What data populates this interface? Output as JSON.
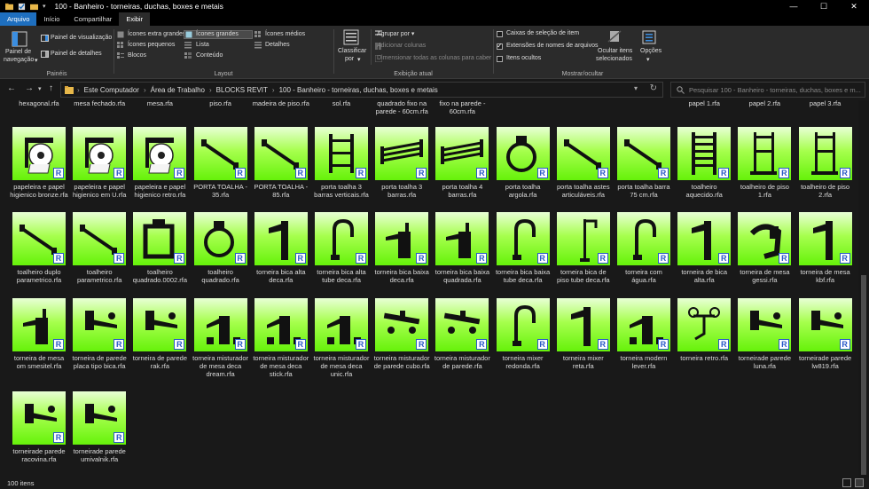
{
  "window": {
    "title": "100 - Banheiro - torneiras, duchas, boxes e metais",
    "min_glyph": "—",
    "max_glyph": "☐",
    "close_glyph": "✕"
  },
  "tabs": [
    {
      "label": "Arquivo",
      "kind": "file"
    },
    {
      "label": "Início",
      "kind": ""
    },
    {
      "label": "Compartilhar",
      "kind": ""
    },
    {
      "label": "Exibir",
      "kind": "active"
    }
  ],
  "ribbon": {
    "panes": {
      "nav_pane_1": "Painel de",
      "nav_pane_2": "navegação",
      "nav_pane_arrow": "▾",
      "preview": "Painel de visualização",
      "details": "Painel de detalhes",
      "group": "Painéis"
    },
    "layout": {
      "extra_large": "Ícones extra grandes",
      "large": "Ícones grandes",
      "medium": "Ícones médios",
      "small": "Ícones pequenos",
      "list": "Lista",
      "details": "Detalhes",
      "tiles": "Blocos",
      "content": "Conteúdo",
      "group": "Layout"
    },
    "current_view": {
      "sort_1": "Classificar",
      "sort_2": "por",
      "sort_arrow": "▾",
      "group_by": "Agrupar por",
      "add_columns": "Adicionar colunas",
      "size_columns": "Dimensionar todas as colunas para caber",
      "group": "Exibição atual"
    },
    "show_hide": {
      "checkboxes": "Caixas de seleção de item",
      "extensions": "Extensões de nomes de arquivos",
      "hidden": "Itens ocultos",
      "hide_selected_1": "Ocultar itens",
      "hide_selected_2": "selecionados",
      "options": "Opções",
      "options_arrow": "▾",
      "group": "Mostrar/ocultar",
      "checkboxes_checked": false,
      "extensions_checked": true,
      "hidden_checked": false
    }
  },
  "address": {
    "back": "←",
    "forward": "→",
    "recent": "▾",
    "up": "↑",
    "crumbs": [
      "Este Computador",
      "Área de Trabalho",
      "BLOCKS REVIT",
      "100 - Banheiro - torneiras, duchas, boxes e metais"
    ],
    "dropdown": "▾",
    "refresh": "↻",
    "search_placeholder": "Pesquisar 100 - Banheiro - torneiras, duchas, boxes e m...",
    "crumb_sep": "›"
  },
  "partial_row": [
    "hexagonal.rfa",
    "mesa fechado.rfa",
    "mesa.rfa",
    "piso.rfa",
    "madeira de piso.rfa",
    "sol.rfa",
    "quadrado fixo na parede - 60cm.rfa",
    "fixo na parede - 60cm.rfa",
    "",
    "",
    "",
    "papel 1.rfa",
    "papel 2.rfa",
    "papel 3.rfa"
  ],
  "files": [
    {
      "name": "papeleira e papel higienico bronze.rfa",
      "icon": "toilet-paper-holder-icon"
    },
    {
      "name": "papeleira e papel higienico em U.rfa",
      "icon": "toilet-paper-holder-icon"
    },
    {
      "name": "papeleira e papel higienico retro.rfa",
      "icon": "toilet-paper-holder-icon"
    },
    {
      "name": "PORTA TOALHA - 35.rfa",
      "icon": "towel-bar-icon"
    },
    {
      "name": "PORTA TOALHA - 85.rfa",
      "icon": "towel-bar-icon"
    },
    {
      "name": "porta toalha 3 barras verticais.rfa",
      "icon": "towel-rack-icon"
    },
    {
      "name": "porta toalha 3 barras.rfa",
      "icon": "towel-shelf-icon"
    },
    {
      "name": "porta toalha 4 barras.rfa",
      "icon": "towel-shelf-icon"
    },
    {
      "name": "porta toalha argola.rfa",
      "icon": "towel-ring-icon"
    },
    {
      "name": "porta toalha astes articuláveis.rfa",
      "icon": "towel-bar-icon"
    },
    {
      "name": "porta toalha barra 75 cm.rfa",
      "icon": "towel-bar-icon"
    },
    {
      "name": "toalheiro aquecido.rfa",
      "icon": "heated-towel-rail-icon"
    },
    {
      "name": "toalheiro de piso 1.rfa",
      "icon": "floor-towel-stand-icon"
    },
    {
      "name": "toalheiro de piso 2.rfa",
      "icon": "floor-towel-stand-icon"
    },
    {
      "name": "toalheiro duplo parametrico.rfa",
      "icon": "towel-bar-icon"
    },
    {
      "name": "toalheiro parametrico.rfa",
      "icon": "towel-bar-icon"
    },
    {
      "name": "toalheiro quadrado.0002.rfa",
      "icon": "square-towel-ring-icon"
    },
    {
      "name": "toalheiro quadrado.rfa",
      "icon": "towel-ring-icon"
    },
    {
      "name": "torneira bica alta deca.rfa",
      "icon": "tall-faucet-icon"
    },
    {
      "name": "torneira bica alta tube deca.rfa",
      "icon": "gooseneck-faucet-icon"
    },
    {
      "name": "torneira bica baixa deca.rfa",
      "icon": "low-faucet-icon"
    },
    {
      "name": "torneira bica baixa quadrada.rfa",
      "icon": "low-faucet-icon"
    },
    {
      "name": "torneira bica baixa tube deca.rfa",
      "icon": "gooseneck-faucet-icon"
    },
    {
      "name": "torneira bica de piso tube deca.rfa",
      "icon": "floor-faucet-icon"
    },
    {
      "name": "torneira com água.rfa",
      "icon": "gooseneck-faucet-icon"
    },
    {
      "name": "torneira de bica alta.rfa",
      "icon": "tall-faucet-icon"
    },
    {
      "name": "torneira de mesa gessi.rfa",
      "icon": "curved-faucet-icon"
    },
    {
      "name": "torneira de mesa kbf.rfa",
      "icon": "tall-faucet-icon"
    },
    {
      "name": "torneira de mesa om smesitel.rfa",
      "icon": "low-faucet-icon"
    },
    {
      "name": "torneira de parede placa tipo bica.rfa",
      "icon": "wall-faucet-icon"
    },
    {
      "name": "torneira de parede rak.rfa",
      "icon": "wall-faucet-icon"
    },
    {
      "name": "torneira misturador de mesa deca dream.rfa",
      "icon": "mixer-faucet-icon"
    },
    {
      "name": "torneira misturador de mesa deca stick.rfa",
      "icon": "mixer-faucet-icon"
    },
    {
      "name": "torneira misturador de mesa deca unic.rfa",
      "icon": "mixer-faucet-icon"
    },
    {
      "name": "torneira misturador de parede cubo.rfa",
      "icon": "wall-mixer-icon"
    },
    {
      "name": "torneira misturador de parede.rfa",
      "icon": "wall-mixer-icon"
    },
    {
      "name": "torneira mixer redonda.rfa",
      "icon": "gooseneck-faucet-icon"
    },
    {
      "name": "torneira mixer reta.rfa",
      "icon": "tall-faucet-icon"
    },
    {
      "name": "torneira modern lever.rfa",
      "icon": "mixer-faucet-icon"
    },
    {
      "name": "torneira retro.rfa",
      "icon": "retro-faucet-icon"
    },
    {
      "name": "torneirade parede luna.rfa",
      "icon": "wall-faucet-icon"
    },
    {
      "name": "torneirade parede lw819.rfa",
      "icon": "wall-faucet-icon"
    },
    {
      "name": "torneirade parede racovina.rfa",
      "icon": "wall-faucet-icon"
    },
    {
      "name": "torneirade parede umivalnik.rfa",
      "icon": "wall-faucet-icon"
    }
  ],
  "revit_badge": "R",
  "status": {
    "count": "100 itens"
  }
}
